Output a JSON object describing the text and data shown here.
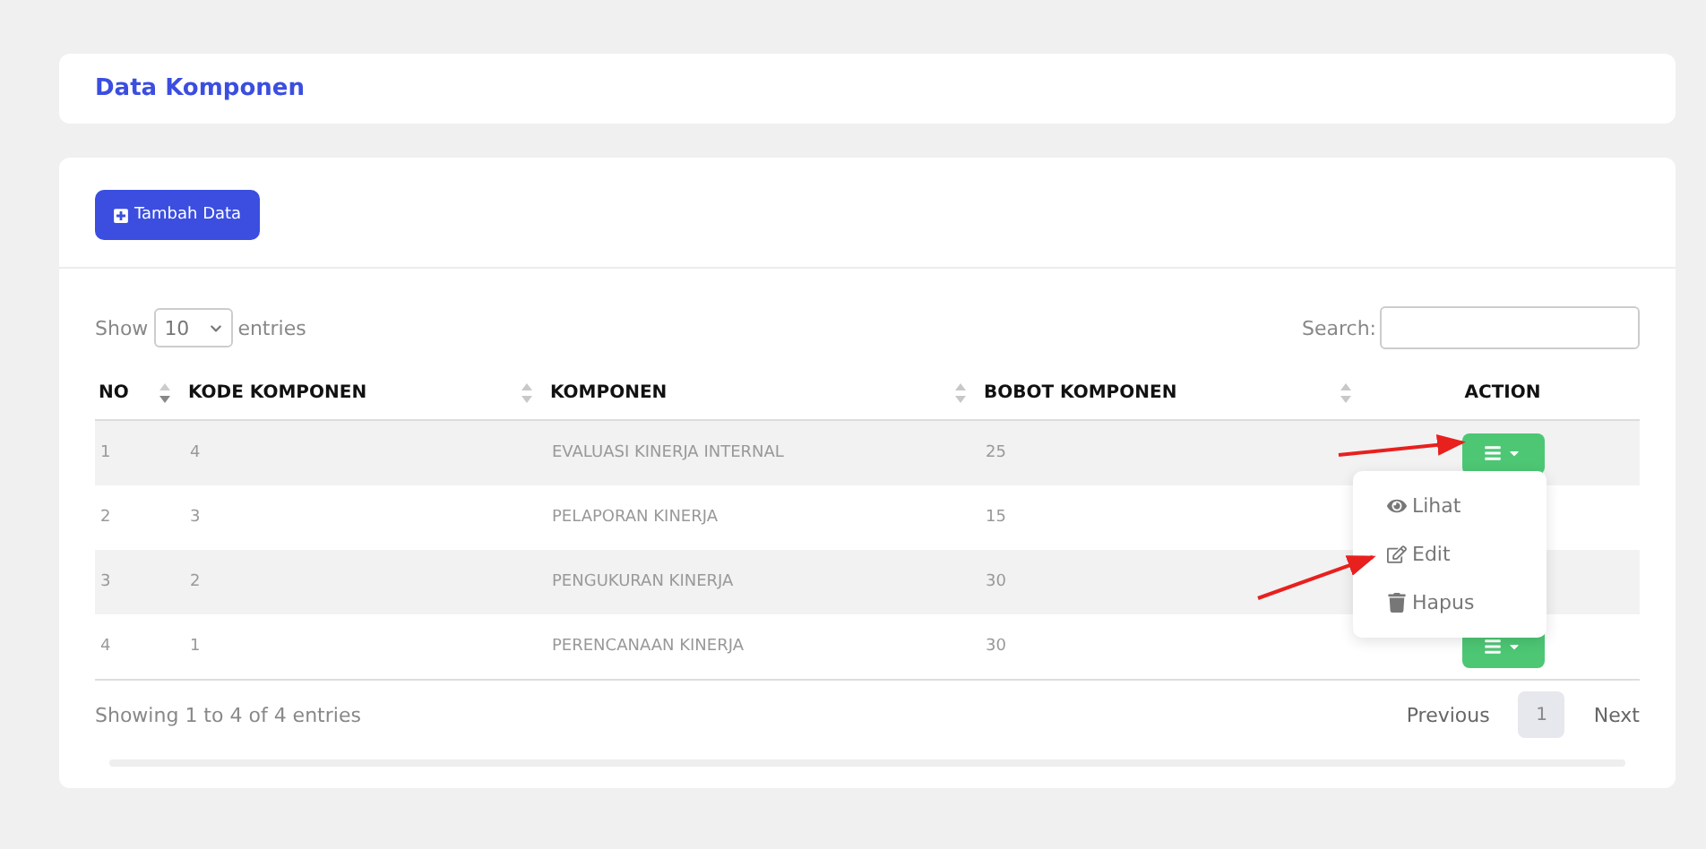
{
  "header": {
    "title": "Data Komponen"
  },
  "add_button": {
    "label": "Tambah Data"
  },
  "length_control": {
    "prefix": "Show",
    "value": "10",
    "suffix": "entries"
  },
  "search": {
    "label": "Search:"
  },
  "table": {
    "columns": [
      {
        "label": "NO",
        "sortable": true,
        "sorted": true
      },
      {
        "label": "KODE KOMPONEN",
        "sortable": true,
        "sorted": false
      },
      {
        "label": "KOMPONEN",
        "sortable": true,
        "sorted": false
      },
      {
        "label": "BOBOT KOMPONEN",
        "sortable": true,
        "sorted": false
      },
      {
        "label": "ACTION",
        "sortable": false
      }
    ],
    "rows": [
      {
        "cells": [
          "1",
          "4",
          "EVALUASI KINERJA INTERNAL",
          "25"
        ],
        "action_button": true
      },
      {
        "cells": [
          "2",
          "3",
          "PELAPORAN KINERJA",
          "15"
        ]
      },
      {
        "cells": [
          "3",
          "2",
          "PENGUKURAN KINERJA",
          "30"
        ]
      },
      {
        "cells": [
          "4",
          "1",
          "PERENCANAAN KINERJA",
          "30"
        ],
        "action_button": true
      }
    ]
  },
  "dropdown": {
    "items": [
      {
        "kind": "view",
        "label": "Lihat"
      },
      {
        "kind": "edit",
        "label": "Edit"
      },
      {
        "kind": "delete",
        "label": "Hapus"
      }
    ]
  },
  "info": "Showing 1 to 4 of 4 entries",
  "pagination": {
    "previous": "Previous",
    "pages": [
      {
        "label": "1",
        "selected": true
      }
    ],
    "next": "Next"
  }
}
